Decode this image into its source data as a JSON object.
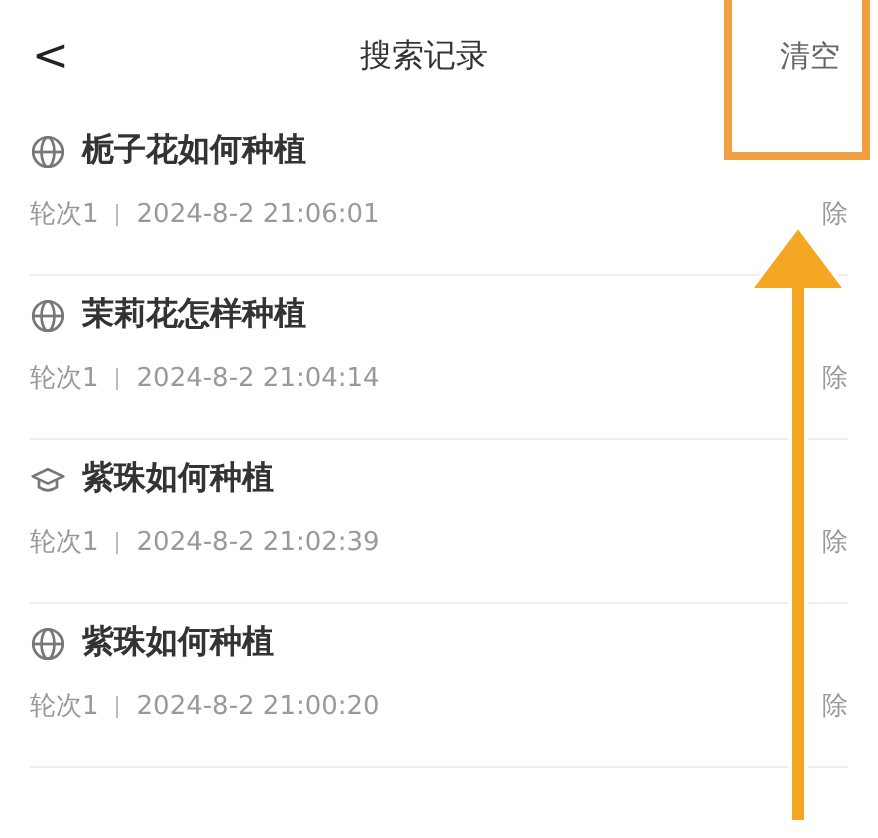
{
  "header": {
    "back": "<",
    "title": "搜索记录",
    "action": "清空"
  },
  "records": [
    {
      "kind": "web",
      "query": "栀子花如何种植",
      "round": "轮次1",
      "time": "2024-8-2 21:06:01",
      "delete": "除"
    },
    {
      "kind": "web",
      "query": "茉莉花怎样种植",
      "round": "轮次1",
      "time": "2024-8-2 21:04:14",
      "delete": "除"
    },
    {
      "kind": "academic",
      "query": "紫珠如何种植",
      "round": "轮次1",
      "time": "2024-8-2 21:02:39",
      "delete": "除"
    },
    {
      "kind": "web",
      "query": "紫珠如何种植",
      "round": "轮次1",
      "time": "2024-8-2 21:00:20",
      "delete": "除"
    }
  ]
}
